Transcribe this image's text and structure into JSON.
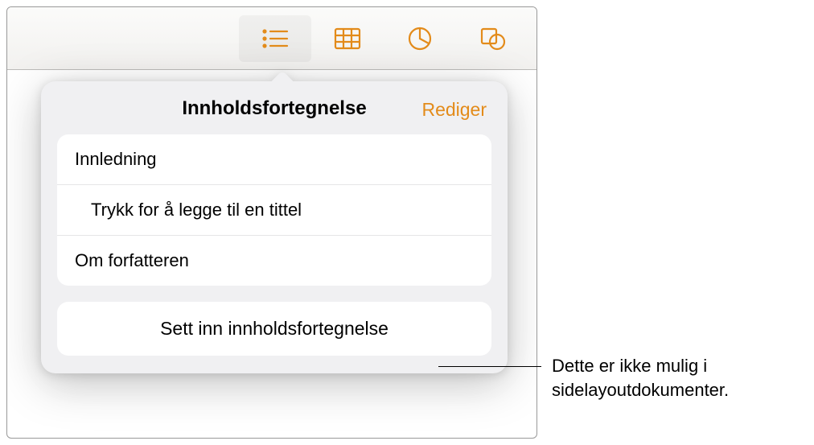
{
  "colors": {
    "accent": "#e38b1a"
  },
  "toolbar": {
    "icons": [
      "list-icon",
      "table-icon",
      "chart-icon",
      "shape-icon"
    ]
  },
  "popover": {
    "title": "Innholdsfortegnelse",
    "edit_label": "Rediger",
    "toc_items": [
      {
        "label": "Innledning",
        "indent": false
      },
      {
        "label": "Trykk for å legge til en tittel",
        "indent": true
      },
      {
        "label": "Om forfatteren",
        "indent": false
      }
    ],
    "insert_label": "Sett inn innholdsfortegnelse"
  },
  "callout": {
    "text": "Dette er ikke mulig i sidelayoutdokumenter."
  }
}
